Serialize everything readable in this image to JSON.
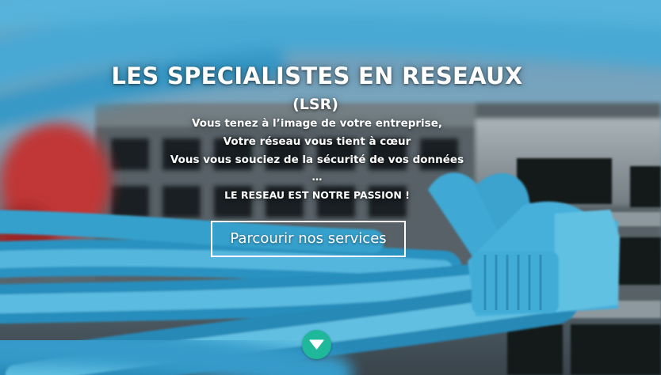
{
  "hero": {
    "title": "LES SPECIALISTES EN RESEAUX",
    "subtitle": "(LSR)",
    "lines": [
      "Vous tenez à l’image de votre entreprise,",
      "Votre réseau vous tient à cœur",
      "Vous vous souciez de la sécurité de vos données",
      "…",
      "LE RESEAU EST NOTRE PASSION !"
    ],
    "cta_label": "Parcourir nos services",
    "scroll_icon": "chevron-down-icon"
  },
  "colors": {
    "text": "#ffffff",
    "scroll_button": "#1fb89a",
    "cable": "#3fb3de"
  }
}
